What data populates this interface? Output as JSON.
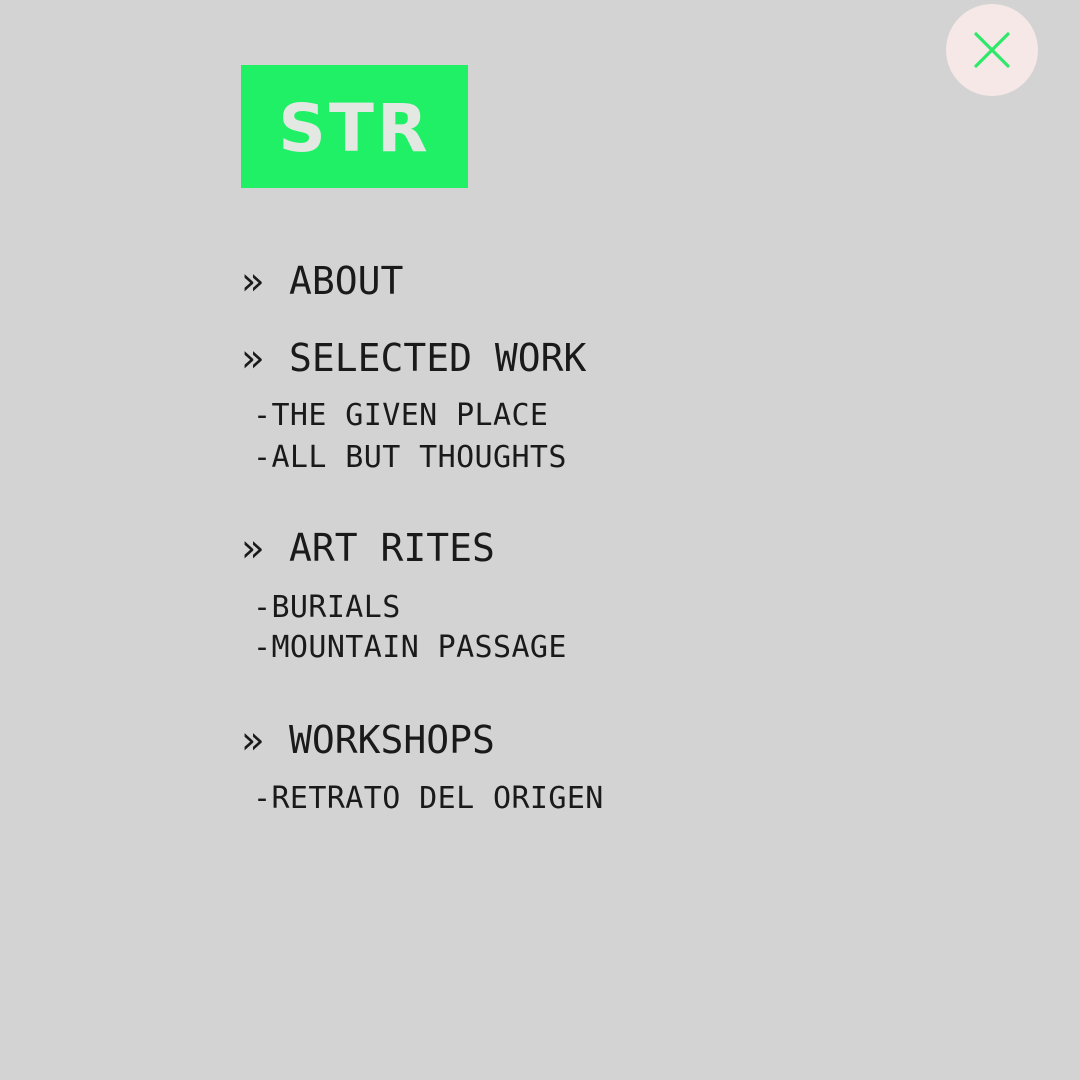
{
  "close": {
    "icon": "close-icon",
    "color": "#2ee86a"
  },
  "logo": {
    "text": "STR",
    "background": "#1ff065"
  },
  "menu": {
    "marker": "»",
    "sections": [
      {
        "label": "ABOUT",
        "items": []
      },
      {
        "label": "SELECTED WORK",
        "items": [
          "-THE GIVEN PLACE",
          "-ALL BUT THOUGHTS"
        ]
      },
      {
        "label": "ART RITES",
        "items": [
          "-BURIALS",
          "-MOUNTAIN PASSAGE"
        ]
      },
      {
        "label": "WORKSHOPS",
        "items": [
          "-RETRATO DEL ORIGEN"
        ]
      }
    ]
  }
}
